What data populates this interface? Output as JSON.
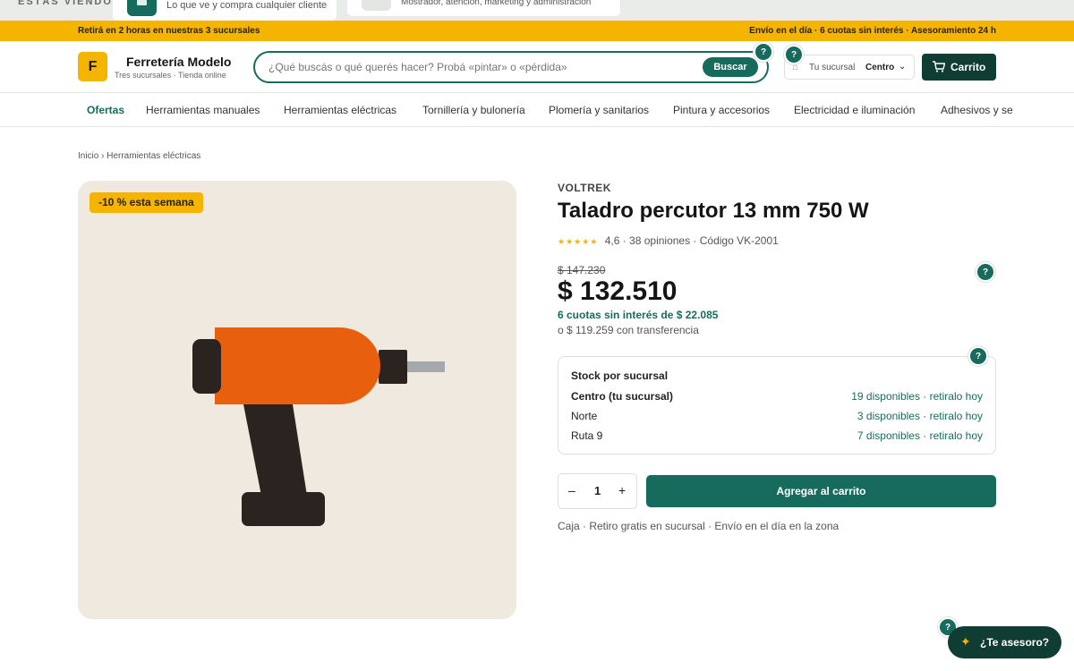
{
  "top_strip": {
    "viewing_label": "ESTÁS VIENDO",
    "card1_text": "Lo que ve y compra cualquier cliente",
    "card2_text": "Mostrador, atención, marketing y administración"
  },
  "promo_bar": {
    "left": "Retirá en 2 horas en nuestras 3 sucursales",
    "right": "Envío en el día · 6 cuotas sin interés · Asesoramiento 24 h"
  },
  "header": {
    "logo_letter": "F",
    "brand": "Ferretería Modelo",
    "brand_sub": "Tres sucursales · Tienda online",
    "search_placeholder": "¿Qué buscás o qué querés hacer? Probá «pintar» o «pérdida»",
    "search_button": "Buscar",
    "branch_label": "Tu sucursal",
    "branch_value": "Centro",
    "cart_label": "Carrito",
    "help_label": "?"
  },
  "nav": {
    "items": [
      "Ofertas",
      "Herramientas manuales",
      "Herramientas eléctricas",
      "Tornillería y bulonería",
      "Plomería y sanitarios",
      "Pintura y accesorios",
      "Electricidad e iluminación",
      "Adhesivos y se"
    ]
  },
  "breadcrumb": "Inicio › Herramientas eléctricas",
  "product": {
    "discount_badge": "-10 % esta semana",
    "brand": "VOLTREK",
    "title": "Taladro percutor 13 mm 750 W",
    "stars": "★★★★★",
    "rating_text": "4,6 · 38 opiniones · Código VK-2001",
    "rating": 4.6,
    "old_price": "$ 147.230",
    "price": "$ 132.510",
    "installments": "6 cuotas sin interés de $ 22.085",
    "transfer": "o $ 119.259 con transferencia",
    "stock_title": "Stock por sucursal",
    "stock": [
      {
        "name": "Centro (tu sucursal)",
        "availability": "19 disponibles · retiralo hoy"
      },
      {
        "name": "Norte",
        "availability": "3 disponibles · retiralo hoy"
      },
      {
        "name": "Ruta 9",
        "availability": "7 disponibles · retiralo hoy"
      }
    ],
    "quantity": "1",
    "qty_minus": "–",
    "qty_plus": "+",
    "add_to_cart": "Agregar al carrito",
    "delivery_note": "Caja · Retiro gratis en sucursal · Envío en el día en la zona"
  },
  "advisor": {
    "label": "¿Te asesoro?"
  },
  "colors": {
    "accent": "#176b5c",
    "dark": "#0f3d33",
    "yellow": "#f4b400",
    "drill_body": "#e8600e",
    "drill_grip": "#2a231f"
  }
}
